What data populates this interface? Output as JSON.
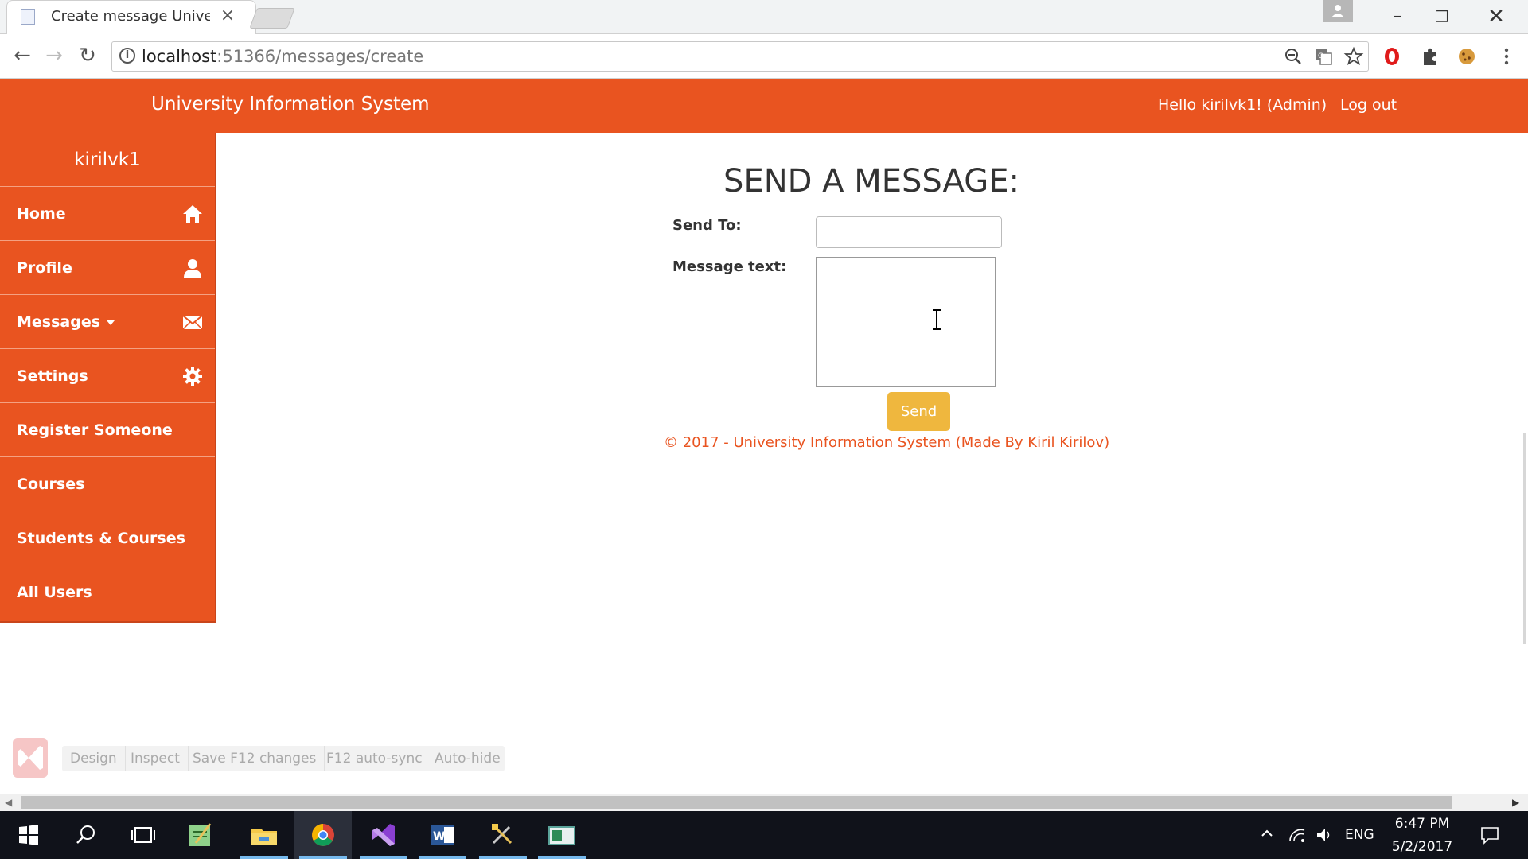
{
  "browser": {
    "tab_title": "Create message Universi",
    "tab_close": "×",
    "url_host": "localhost",
    "url_rest": ":51366/messages/create",
    "window_min": "–",
    "window_max": "❐",
    "window_close": "✕",
    "nav": {
      "back": "←",
      "forward": "→",
      "reload": "↻"
    },
    "toolbar_icons": [
      "zoom-icon",
      "translate-icon",
      "bookmark-star-icon",
      "extension-opera-icon",
      "puzzle-icon",
      "cookie-icon",
      "menu-icon"
    ]
  },
  "site": {
    "brand": "University Information System",
    "greeting": "Hello kirilvk1! (Admin)",
    "logout": "Log out",
    "accent_color": "#e95420",
    "button_color": "#efb73e"
  },
  "sidebar": {
    "username": "kirilvk1",
    "items": [
      {
        "label": "Home",
        "icon": "home-icon"
      },
      {
        "label": "Profile",
        "icon": "user-icon"
      },
      {
        "label": "Messages",
        "icon": "envelope-icon",
        "has_caret": true
      },
      {
        "label": "Settings",
        "icon": "gear-icon"
      },
      {
        "label": "Register Someone"
      },
      {
        "label": "Courses"
      },
      {
        "label": "Students & Courses"
      },
      {
        "label": "All Users"
      }
    ]
  },
  "form": {
    "title": "SEND A MESSAGE:",
    "send_to_label": "Send To:",
    "send_to_value": "",
    "message_label": "Message text:",
    "message_value": "",
    "send_button": "Send"
  },
  "footer": {
    "text": "© 2017 - University Information System (Made By Kiril Kirilov)"
  },
  "vs_browser_link": {
    "buttons": [
      "Design",
      "Inspect",
      "Save F12 changes",
      "F12 auto-sync",
      "Auto-hide"
    ]
  },
  "taskbar": {
    "apps": [
      "windows-start-icon",
      "search-icon",
      "task-view-icon",
      "notepad-icon",
      "file-explorer-icon",
      "chrome-icon",
      "visual-studio-icon",
      "word-icon",
      "tools-icon",
      "app-icon"
    ],
    "language": "ENG",
    "time": "6:47 PM",
    "date": "5/2/2017"
  }
}
